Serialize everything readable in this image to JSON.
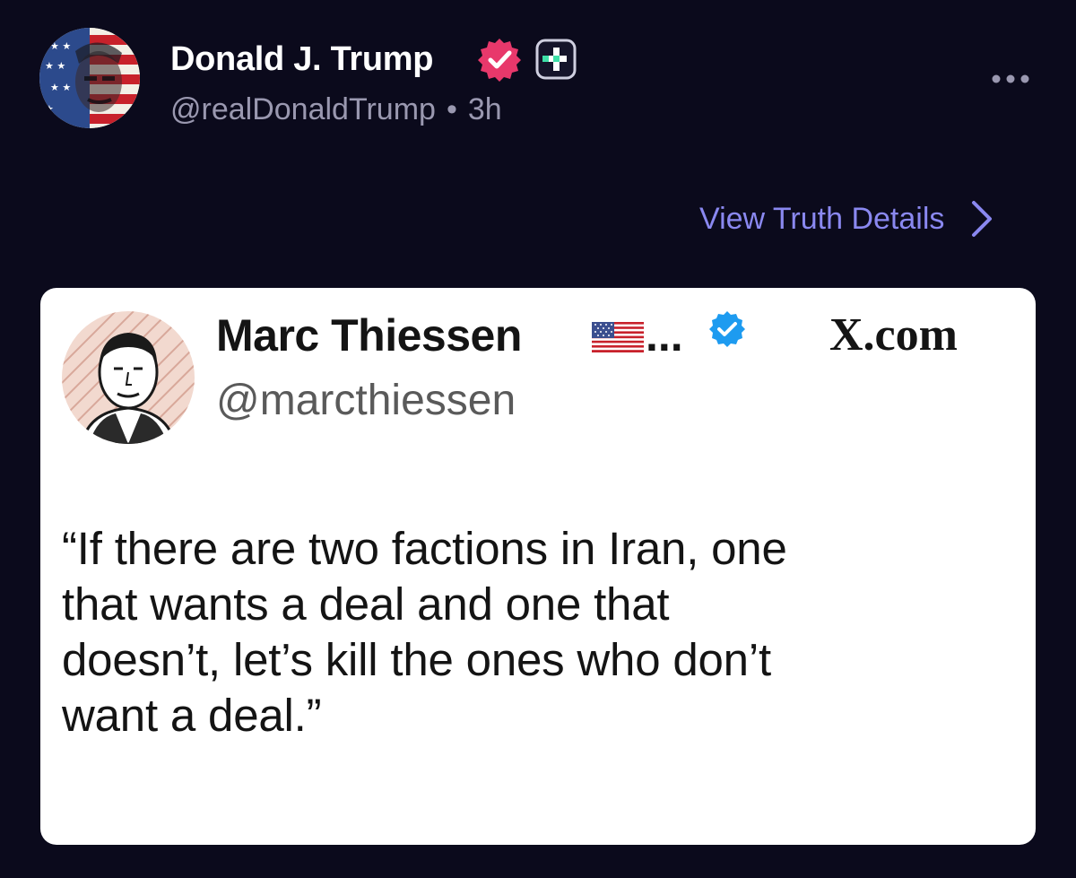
{
  "post": {
    "author_name": "Donald J. Trump",
    "handle": "@realDonaldTrump",
    "separator": "•",
    "timestamp": "3h",
    "view_details_label": "View Truth Details"
  },
  "embed": {
    "author_name": "Marc Thiessen",
    "name_truncation": "...",
    "handle": "@marcthiessen",
    "source": "X.com",
    "quote_lines": [
      "“If there are two factions in Iran, one",
      "that wants a deal and one that",
      "doesn’t, let’s kill the ones who don’t",
      "want a deal.”"
    ]
  },
  "icons": {
    "verified_badge": "verified-badge-icon",
    "plus_badge": "truth-plus-icon",
    "more": "more-horizontal-icon",
    "chevron": "chevron-right-icon",
    "flag": "us-flag-icon",
    "embed_verified": "blue-check-icon"
  },
  "colors": {
    "background": "#0b0a1c",
    "link": "#8a88f0",
    "verified_pink": "#e8386b",
    "plus_green": "#3fe0a8",
    "embed_verified_blue": "#1d9bf0",
    "muted_text": "#9a98b0"
  }
}
